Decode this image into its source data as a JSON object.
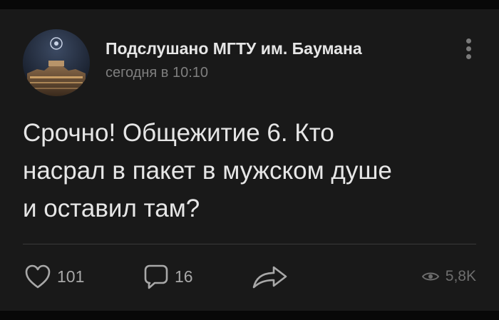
{
  "post": {
    "author": "Подслушано МГТУ им. Баумана",
    "timestamp": "сегодня в 10:10",
    "text_lines": [
      "Срочно! Общежитие 6. Кто",
      "насрал в пакет в мужском душе",
      "и оставил там?"
    ]
  },
  "actions": {
    "likes": "101",
    "comments": "16",
    "views": "5,8K"
  },
  "icons": {
    "like": "heart-icon",
    "comment": "comment-bubble-icon",
    "share": "share-arrow-icon",
    "views": "eye-icon",
    "more": "more-vertical-icon"
  },
  "colors": {
    "background": "#191919",
    "text": "#e6e6e6",
    "secondary_text": "#7f7f7f",
    "icon": "#a8a8a8"
  }
}
